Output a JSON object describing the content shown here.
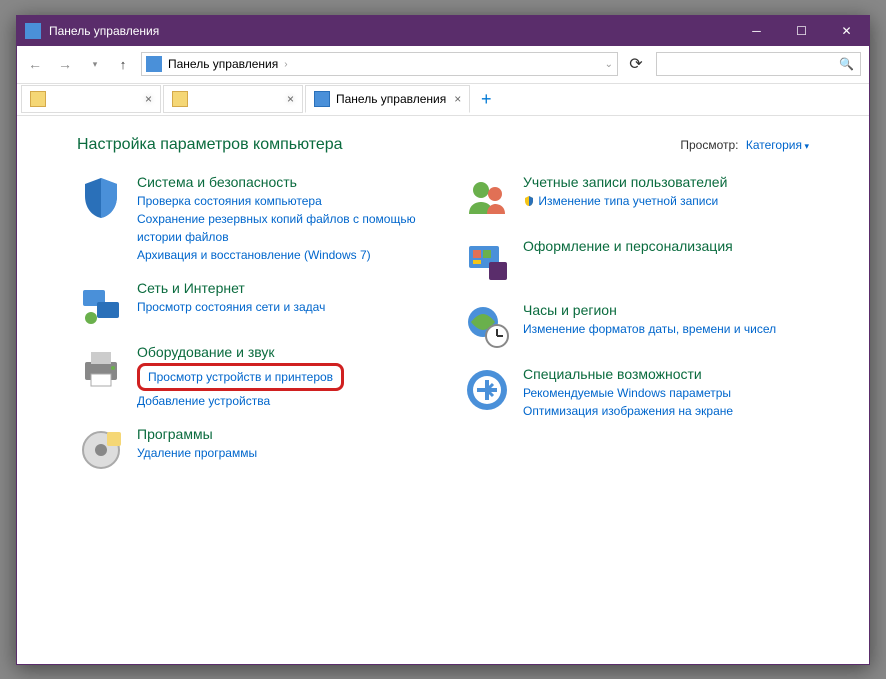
{
  "titlebar": {
    "title": "Панель управления"
  },
  "breadcrumb": {
    "path": "Панель управления"
  },
  "tabs": [
    {
      "label": "                ",
      "active": false,
      "icon": "folder"
    },
    {
      "label": "           ",
      "active": false,
      "icon": "folder"
    },
    {
      "label": "Панель управления",
      "active": true,
      "icon": "cp"
    }
  ],
  "header": {
    "title": "Настройка параметров компьютера",
    "view_label": "Просмотр:",
    "view_value": "Категория"
  },
  "left": [
    {
      "title": "Система и безопасность",
      "links": [
        "Проверка состояния компьютера",
        "Сохранение резервных копий файлов с помощью истории файлов",
        "Архивация и восстановление (Windows 7)"
      ]
    },
    {
      "title": "Сеть и Интернет",
      "links": [
        "Просмотр состояния сети и задач"
      ]
    },
    {
      "title": "Оборудование и звук",
      "links": [
        "Просмотр устройств и принтеров",
        "Добавление устройства"
      ],
      "highlight_index": 0
    },
    {
      "title": "Программы",
      "links": [
        "Удаление программы"
      ]
    }
  ],
  "right": [
    {
      "title": "Учетные записи пользователей",
      "links": [
        "Изменение типа учетной записи"
      ],
      "badge": true
    },
    {
      "title": "Оформление и персонализация",
      "links": []
    },
    {
      "title": "Часы и регион",
      "links": [
        "Изменение форматов даты, времени и чисел"
      ]
    },
    {
      "title": "Специальные возможности",
      "links": [
        "Рекомендуемые Windows параметры",
        "Оптимизация изображения на экране"
      ]
    }
  ]
}
